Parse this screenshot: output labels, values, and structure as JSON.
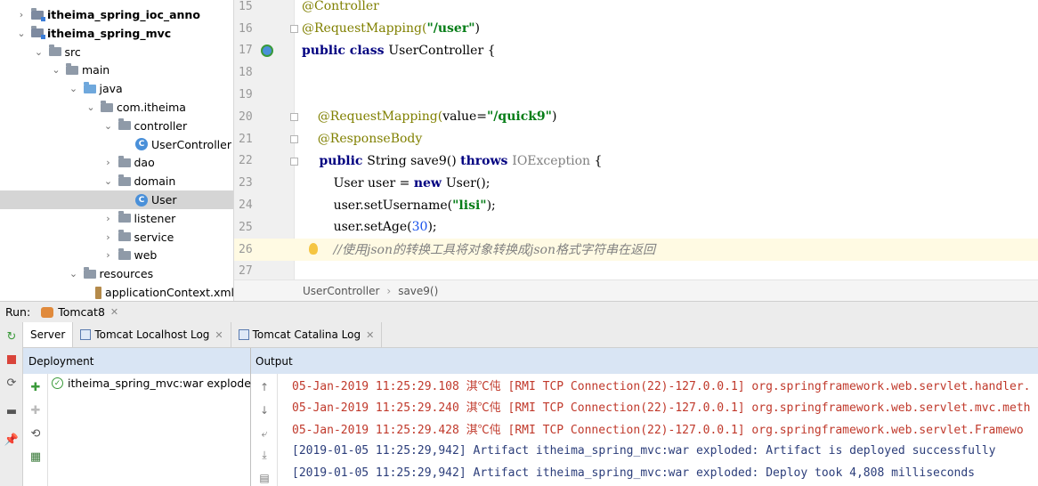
{
  "tree": {
    "items": [
      {
        "label": "itheima_spring_ioc_anno",
        "arrow": "›",
        "type": "module",
        "indent": 0
      },
      {
        "label": "itheima_spring_mvc",
        "arrow": "⌄",
        "type": "module",
        "indent": 0
      },
      {
        "label": "src",
        "arrow": "⌄",
        "type": "folder",
        "indent": 1
      },
      {
        "label": "main",
        "arrow": "⌄",
        "type": "folder",
        "indent": 2
      },
      {
        "label": "java",
        "arrow": "⌄",
        "type": "folder-blue",
        "indent": 3
      },
      {
        "label": "com.itheima",
        "arrow": "⌄",
        "type": "folder",
        "indent": 4
      },
      {
        "label": "controller",
        "arrow": "⌄",
        "type": "folder",
        "indent": 5
      },
      {
        "label": "UserController",
        "arrow": "",
        "type": "class",
        "indent": 6
      },
      {
        "label": "dao",
        "arrow": "›",
        "type": "folder",
        "indent": 5
      },
      {
        "label": "domain",
        "arrow": "⌄",
        "type": "folder",
        "indent": 5
      },
      {
        "label": "User",
        "arrow": "",
        "type": "class",
        "indent": 6
      },
      {
        "label": "listener",
        "arrow": "›",
        "type": "folder",
        "indent": 5
      },
      {
        "label": "service",
        "arrow": "›",
        "type": "folder",
        "indent": 5
      },
      {
        "label": "web",
        "arrow": "›",
        "type": "folder",
        "indent": 5
      },
      {
        "label": "resources",
        "arrow": "⌄",
        "type": "folder",
        "indent": 3
      },
      {
        "label": "applicationContext.xml",
        "arrow": "",
        "type": "xml",
        "indent": 4
      }
    ]
  },
  "editor": {
    "lines": [
      {
        "num": "15",
        "parts": [
          {
            "t": "@Controller",
            "c": "ann"
          }
        ]
      },
      {
        "num": "16",
        "parts": [
          {
            "t": "@RequestMapping(",
            "c": "ann"
          },
          {
            "t": "\"/user\"",
            "c": "str"
          },
          {
            "t": ")",
            "c": ""
          }
        ]
      },
      {
        "num": "17",
        "parts": [
          {
            "t": "public class ",
            "c": "kw"
          },
          {
            "t": "UserController {",
            "c": ""
          }
        ]
      },
      {
        "num": "18",
        "parts": []
      },
      {
        "num": "19",
        "parts": []
      },
      {
        "num": "20",
        "parts": [
          {
            "t": "    @RequestMapping(",
            "c": "ann"
          },
          {
            "t": "value=",
            "c": ""
          },
          {
            "t": "\"/quick9\"",
            "c": "str"
          },
          {
            "t": ")",
            "c": ""
          }
        ]
      },
      {
        "num": "21",
        "parts": [
          {
            "t": "    @ResponseBody",
            "c": "ann"
          }
        ]
      },
      {
        "num": "22",
        "parts": [
          {
            "t": "    public ",
            "c": "kw"
          },
          {
            "t": "String save9() ",
            "c": ""
          },
          {
            "t": "throws ",
            "c": "kw"
          },
          {
            "t": "IOException",
            "c": "gray"
          },
          {
            "t": " {",
            "c": ""
          }
        ]
      },
      {
        "num": "23",
        "parts": [
          {
            "t": "        User user = ",
            "c": ""
          },
          {
            "t": "new ",
            "c": "kw"
          },
          {
            "t": "User();",
            "c": ""
          }
        ]
      },
      {
        "num": "24",
        "parts": [
          {
            "t": "        user.setUsername(",
            "c": ""
          },
          {
            "t": "\"lisi\"",
            "c": "str"
          },
          {
            "t": ");",
            "c": ""
          }
        ]
      },
      {
        "num": "25",
        "parts": [
          {
            "t": "        user.setAge(",
            "c": ""
          },
          {
            "t": "30",
            "c": "num"
          },
          {
            "t": ");",
            "c": ""
          }
        ]
      },
      {
        "num": "26",
        "parts": [
          {
            "t": "        //使用json的转换工具将对象转换成json格式字符串在返回",
            "c": "cmt"
          }
        ]
      },
      {
        "num": "27",
        "parts": []
      }
    ],
    "breadcrumb": {
      "class_name": "UserController",
      "method_name": "save9()"
    }
  },
  "run": {
    "label": "Run:",
    "config_name": "Tomcat8",
    "tabs": [
      {
        "label": "Server"
      },
      {
        "label": "Tomcat Localhost Log"
      },
      {
        "label": "Tomcat Catalina Log"
      }
    ],
    "deployment_header": "Deployment",
    "output_header": "Output",
    "artifact": "itheima_spring_mvc:war exploded",
    "log": [
      {
        "text": "05-Jan-2019 11:25:29.108 淇℃伅 [RMI TCP Connection(22)-127.0.0.1] org.springframework.web.servlet.handler.",
        "style": "red"
      },
      {
        "text": "05-Jan-2019 11:25:29.240 淇℃伅 [RMI TCP Connection(22)-127.0.0.1] org.springframework.web.servlet.mvc.meth",
        "style": "red"
      },
      {
        "text": "05-Jan-2019 11:25:29.428 淇℃伅 [RMI TCP Connection(22)-127.0.0.1] org.springframework.web.servlet.Framewo",
        "style": "red"
      },
      {
        "text": "[2019-01-05 11:25:29,942] Artifact itheima_spring_mvc:war exploded: Artifact is deployed successfully",
        "style": "blue"
      },
      {
        "text": "[2019-01-05 11:25:29,942] Artifact itheima_spring_mvc:war exploded: Deploy took 4,808 milliseconds",
        "style": "blue"
      }
    ]
  },
  "icons": {
    "rerun": "rerun-icon",
    "stop": "stop-icon",
    "restart": "restart-icon",
    "layout": "layout-icon",
    "pin": "pin-icon"
  },
  "colors": {
    "annotation": "#808000",
    "string": "#067d17",
    "keyword": "#000080",
    "log_red": "#c0392b",
    "log_blue": "#2b3d7a",
    "panel_header": "#d9e5f4"
  }
}
